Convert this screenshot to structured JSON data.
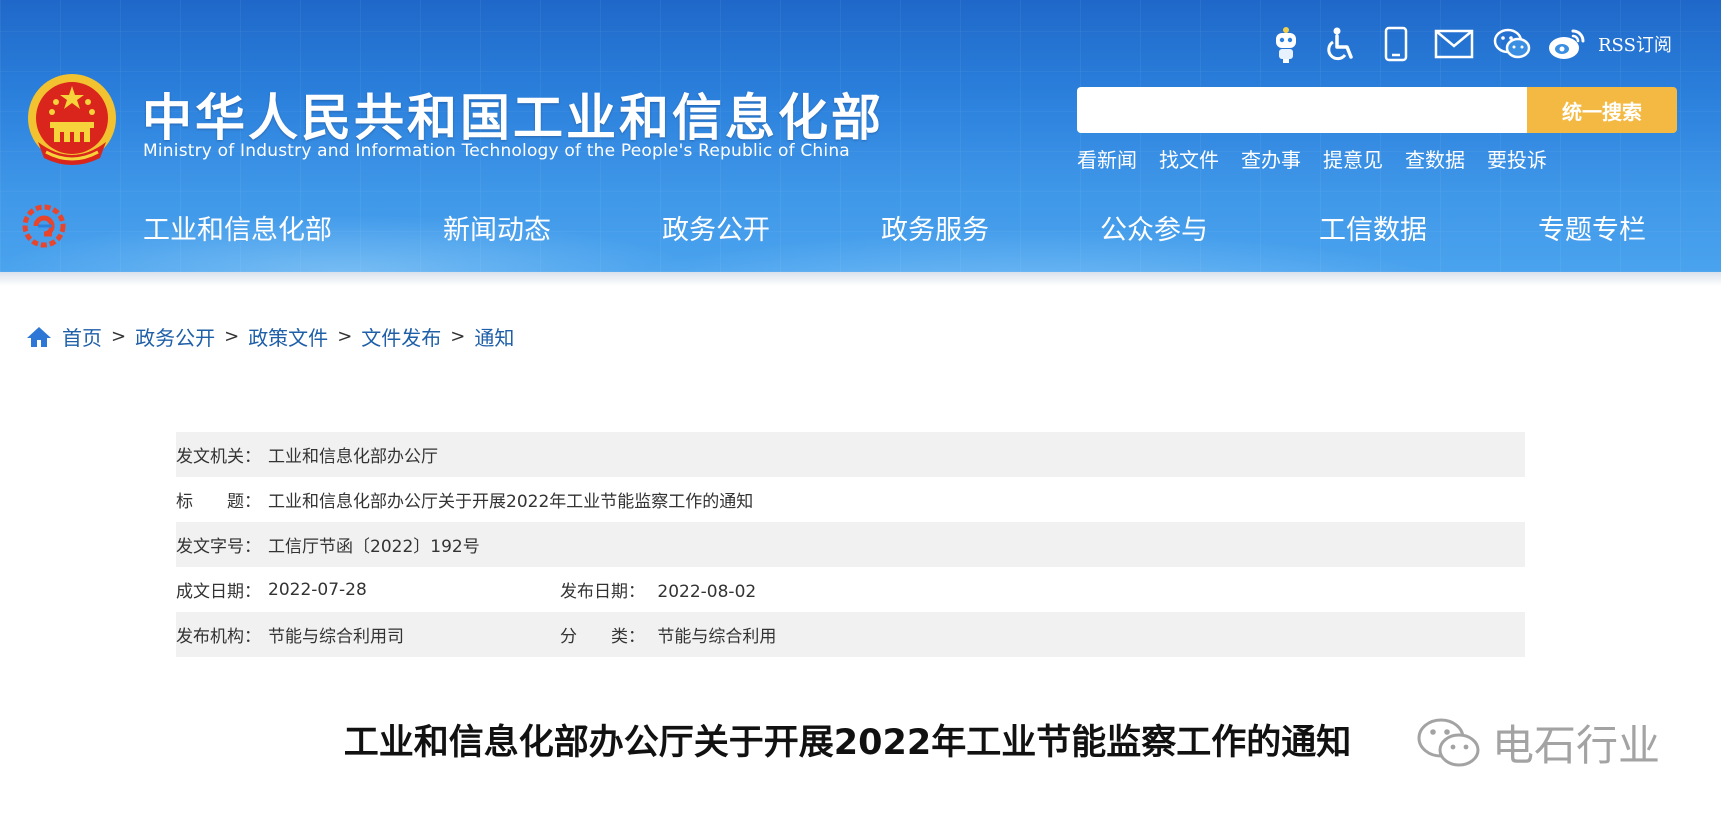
{
  "header": {
    "title": "中华人民共和国工业和信息化部",
    "subtitle": "Ministry of Industry and Information Technology of the People's Republic of China",
    "rss_label": "RSS订阅",
    "search": {
      "placeholder": "",
      "button_label": "统一搜索"
    },
    "quick_links": [
      "看新闻",
      "找文件",
      "查办事",
      "提意见",
      "查数据",
      "要投诉"
    ],
    "toolbar_icons": [
      "robot-assistant-icon",
      "accessibility-icon",
      "mobile-icon",
      "mail-icon",
      "wechat-icon",
      "weibo-icon"
    ]
  },
  "nav": {
    "items": [
      "工业和信息化部",
      "新闻动态",
      "政务公开",
      "政务服务",
      "公众参与",
      "工信数据",
      "专题专栏"
    ]
  },
  "breadcrumb": [
    "首页",
    "政务公开",
    "政策文件",
    "文件发布",
    "通知"
  ],
  "doc_info": {
    "issuer_label": "发文机关：",
    "issuer": "工业和信息化部办公厅",
    "title_label": "标　　题：",
    "title": "工业和信息化部办公厅关于开展2022年工业节能监察工作的通知",
    "number_label": "发文字号：",
    "number": "工信厅节函〔2022〕192号",
    "created_label": "成文日期：",
    "created": "2022-07-28",
    "published_label": "发布日期：",
    "published": "2022-08-02",
    "org_label": "发布机构：",
    "org": "节能与综合利用司",
    "category_label": "分　　类：",
    "category": "节能与综合利用"
  },
  "article": {
    "title": "工业和信息化部办公厅关于开展2022年工业节能监察工作的通知"
  },
  "watermark": {
    "text": "电石行业"
  },
  "colors": {
    "header_blue": "#2b80dc",
    "search_button": "#f4b942",
    "link_blue": "#1e5fa8",
    "row_shade": "#f1f1f1"
  }
}
